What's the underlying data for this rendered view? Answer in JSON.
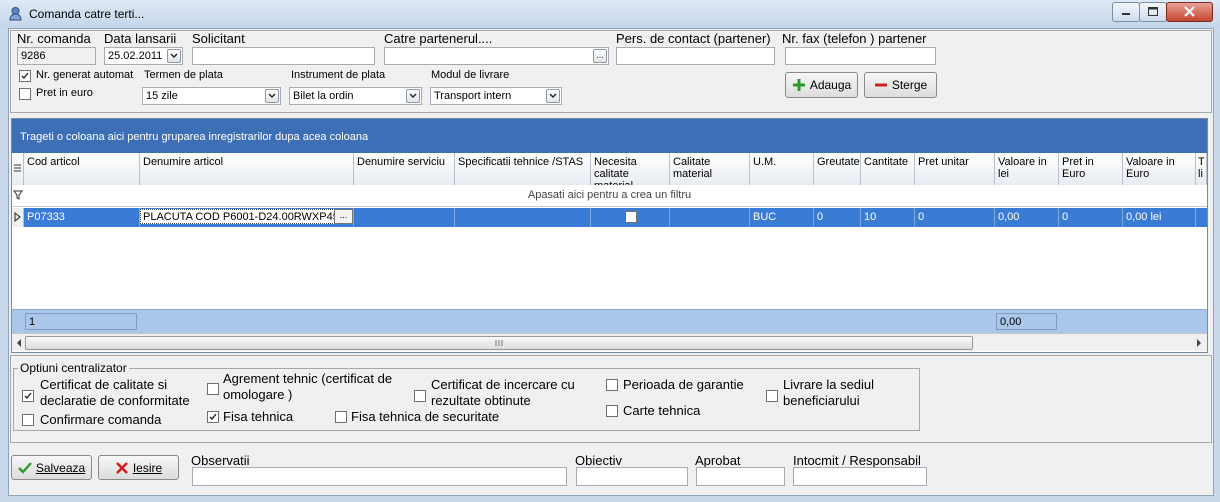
{
  "window": {
    "title": "Comanda catre terti..."
  },
  "header": {
    "nr_comanda_label": "Nr. comanda",
    "nr_comanda_value": "9286",
    "data_lansarii_label": "Data lansarii",
    "data_lansarii_value": "25.02.2011",
    "solicitant_label": "Solicitant",
    "solicitant_value": "",
    "catre_partener_label": "Catre partenerul....",
    "catre_partener_value": "",
    "pers_contact_label": "Pers. de contact (partener)",
    "pers_contact_value": "",
    "nr_fax_label": "Nr. fax (telefon ) partener",
    "nr_fax_value": "",
    "nr_generat_label": "Nr. generat automat",
    "nr_generat_checked": true,
    "pret_euro_label": "Pret in euro",
    "pret_euro_checked": false,
    "termen_plata_label": "Termen de plata",
    "termen_plata_value": "15 zile",
    "instrument_plata_label": "Instrument de plata",
    "instrument_plata_value": "Bilet la ordin",
    "modul_livrare_label": "Modul de livrare",
    "modul_livrare_value": "Transport intern",
    "adauga_label": "Adauga",
    "sterge_label": "Sterge",
    "ellipsis_label": "..."
  },
  "grid": {
    "group_hint": "Trageti o coloana aici pentru gruparea inregistrarilor dupa acea coloana",
    "columns": [
      "Cod articol",
      "Denumire articol",
      "Denumire serviciu",
      "Specificatii tehnice /STAS",
      "Necesita calitate material",
      "Calitate material",
      "U.M.",
      "Greutate",
      "Cantitate",
      "Pret unitar",
      "Valoare in lei",
      "Pret in Euro",
      "Valoare in Euro",
      "T li"
    ],
    "filter_hint": "Apasati aici pentru a crea un filtru",
    "rows": [
      {
        "cod": "P07333",
        "denumire": "PLACUTA COD P6001-D24.00RWXP45",
        "serviciu": "",
        "specificatii": "",
        "necesita_calitate": false,
        "calitate": "",
        "um": "BUC",
        "greutate": "0",
        "cantitate": "10",
        "pret_unitar": "0",
        "valoare_lei": "0,00",
        "pret_euro": "0",
        "valoare_euro": "0,00 lei"
      }
    ],
    "footer_count": "1",
    "footer_total_lei": "0,00"
  },
  "options": {
    "legend": "Optiuni centralizator",
    "items": [
      {
        "label": "Certificat de calitate si declaratie de conformitate",
        "checked": true
      },
      {
        "label": "Confirmare comanda",
        "checked": false
      },
      {
        "label": "Agrement tehnic (certificat de omologare )",
        "checked": false
      },
      {
        "label": "Fisa tehnica",
        "checked": true
      },
      {
        "label": "Certificat de incercare cu rezultate obtinute",
        "checked": false
      },
      {
        "label": "Fisa tehnica de securitate",
        "checked": false
      },
      {
        "label": "Perioada de garantie",
        "checked": false
      },
      {
        "label": "Carte tehnica",
        "checked": false
      },
      {
        "label": "Livrare la sediul beneficiarului",
        "checked": false
      }
    ]
  },
  "bottom": {
    "salveaza_label": "Salveaza",
    "iesire_label": "Iesire",
    "observatii_label": "Observatii",
    "obiectiv_label": "Obiectiv",
    "aprobat_label": "Aprobat",
    "intocmit_label": "Intocmit / Responsabil"
  },
  "colors": {
    "selection": "#3a7bd5",
    "group_bar": "#3d6fb7",
    "footer": "#aac7ea"
  }
}
